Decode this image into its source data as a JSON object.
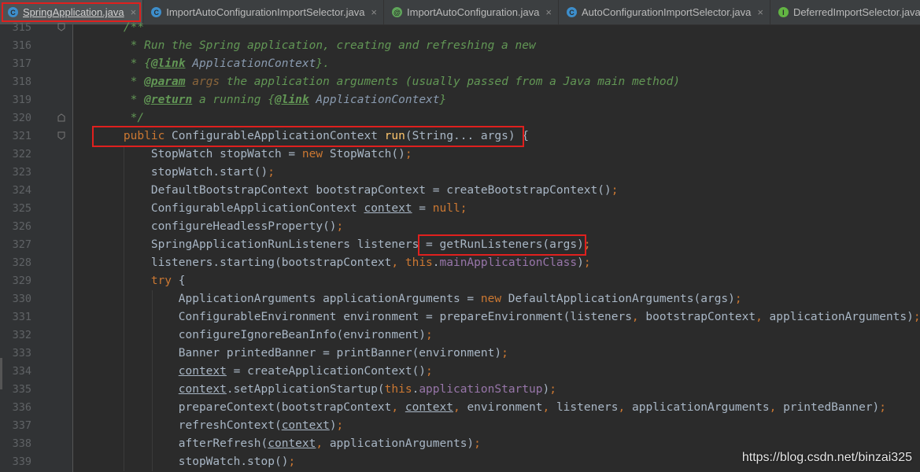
{
  "tabs": [
    {
      "label": "SpringApplication.java",
      "icon": "class-icon",
      "icon_letter": "C",
      "icon_color": "#3d8ecb",
      "active": true
    },
    {
      "label": "ImportAutoConfigurationImportSelector.java",
      "icon": "class-icon",
      "icon_letter": "C",
      "icon_color": "#3d8ecb",
      "active": false
    },
    {
      "label": "ImportAutoConfiguration.java",
      "icon": "annotation-icon",
      "icon_letter": "@",
      "icon_color": "#5fa55a",
      "active": false
    },
    {
      "label": "AutoConfigurationImportSelector.java",
      "icon": "class-icon",
      "icon_letter": "C",
      "icon_color": "#3d8ecb",
      "active": false
    },
    {
      "label": "DeferredImportSelector.java",
      "icon": "interface-icon",
      "icon_letter": "I",
      "icon_color": "#62b543",
      "active": false
    }
  ],
  "close_glyph": "×",
  "editor": {
    "lines": [
      {
        "num": "315",
        "segments": [
          {
            "t": "    /**",
            "c": "doc"
          }
        ]
      },
      {
        "num": "316",
        "segments": [
          {
            "t": "     * Run the Spring application, creating and refreshing a new",
            "c": "doc"
          }
        ]
      },
      {
        "num": "317",
        "segments": [
          {
            "t": "     * {",
            "c": "doc"
          },
          {
            "t": "@link",
            "c": "doctag"
          },
          {
            "t": " ApplicationContext",
            "c": "docref"
          },
          {
            "t": "}.",
            "c": "doc"
          }
        ]
      },
      {
        "num": "318",
        "segments": [
          {
            "t": "     * ",
            "c": "doc"
          },
          {
            "t": "@param",
            "c": "doctag"
          },
          {
            "t": " args",
            "c": "docparam"
          },
          {
            "t": " the application arguments (usually passed from a Java main method)",
            "c": "doc"
          }
        ]
      },
      {
        "num": "319",
        "segments": [
          {
            "t": "     * ",
            "c": "doc"
          },
          {
            "t": "@return",
            "c": "doctag"
          },
          {
            "t": " a running {",
            "c": "doc"
          },
          {
            "t": "@link",
            "c": "doctag"
          },
          {
            "t": " ApplicationContext",
            "c": "docref"
          },
          {
            "t": "}",
            "c": "doc"
          }
        ]
      },
      {
        "num": "320",
        "segments": [
          {
            "t": "     */",
            "c": "doc"
          }
        ]
      },
      {
        "num": "321",
        "segments": [
          {
            "t": "    ",
            "c": "plain"
          },
          {
            "t": "public",
            "c": "kw"
          },
          {
            "t": " ConfigurableApplicationContext ",
            "c": "plain"
          },
          {
            "t": "run",
            "c": "method"
          },
          {
            "t": "(String... args) {",
            "c": "plain"
          }
        ]
      },
      {
        "num": "322",
        "segments": [
          {
            "t": "        StopWatch stopWatch = ",
            "c": "plain"
          },
          {
            "t": "new",
            "c": "kw"
          },
          {
            "t": " StopWatch()",
            "c": "plain"
          },
          {
            "t": ";",
            "c": "kw"
          }
        ]
      },
      {
        "num": "323",
        "segments": [
          {
            "t": "        stopWatch.start()",
            "c": "plain"
          },
          {
            "t": ";",
            "c": "kw"
          }
        ]
      },
      {
        "num": "324",
        "segments": [
          {
            "t": "        DefaultBootstrapContext bootstrapContext = createBootstrapContext()",
            "c": "plain"
          },
          {
            "t": ";",
            "c": "kw"
          }
        ]
      },
      {
        "num": "325",
        "segments": [
          {
            "t": "        ConfigurableApplicationContext ",
            "c": "plain"
          },
          {
            "t": "context",
            "c": "var"
          },
          {
            "t": " = ",
            "c": "plain"
          },
          {
            "t": "null;",
            "c": "kw"
          }
        ]
      },
      {
        "num": "326",
        "segments": [
          {
            "t": "        configureHeadlessProperty()",
            "c": "plain"
          },
          {
            "t": ";",
            "c": "kw"
          }
        ]
      },
      {
        "num": "327",
        "segments": [
          {
            "t": "        SpringApplicationRunListeners listeners = getRunListeners(args)",
            "c": "plain"
          },
          {
            "t": ";",
            "c": "kw"
          }
        ]
      },
      {
        "num": "328",
        "segments": [
          {
            "t": "        listeners.starting(bootstrapContext",
            "c": "plain"
          },
          {
            "t": ", ",
            "c": "kw"
          },
          {
            "t": "this",
            "c": "kw"
          },
          {
            "t": ".",
            "c": "plain"
          },
          {
            "t": "mainApplicationClass",
            "c": "field"
          },
          {
            "t": ")",
            "c": "plain"
          },
          {
            "t": ";",
            "c": "kw"
          }
        ]
      },
      {
        "num": "329",
        "segments": [
          {
            "t": "        ",
            "c": "plain"
          },
          {
            "t": "try",
            "c": "kw"
          },
          {
            "t": " {",
            "c": "plain"
          }
        ]
      },
      {
        "num": "330",
        "segments": [
          {
            "t": "            ApplicationArguments applicationArguments = ",
            "c": "plain"
          },
          {
            "t": "new",
            "c": "kw"
          },
          {
            "t": " DefaultApplicationArguments(args)",
            "c": "plain"
          },
          {
            "t": ";",
            "c": "kw"
          }
        ]
      },
      {
        "num": "331",
        "segments": [
          {
            "t": "            ConfigurableEnvironment environment = prepareEnvironment(listeners",
            "c": "plain"
          },
          {
            "t": ", ",
            "c": "kw"
          },
          {
            "t": "bootstrapContext",
            "c": "plain"
          },
          {
            "t": ", ",
            "c": "kw"
          },
          {
            "t": "applicationArguments)",
            "c": "plain"
          },
          {
            "t": ";",
            "c": "kw"
          }
        ]
      },
      {
        "num": "332",
        "segments": [
          {
            "t": "            configureIgnoreBeanInfo(environment)",
            "c": "plain"
          },
          {
            "t": ";",
            "c": "kw"
          }
        ]
      },
      {
        "num": "333",
        "segments": [
          {
            "t": "            Banner printedBanner = printBanner(environment)",
            "c": "plain"
          },
          {
            "t": ";",
            "c": "kw"
          }
        ]
      },
      {
        "num": "334",
        "segments": [
          {
            "t": "            ",
            "c": "plain"
          },
          {
            "t": "context",
            "c": "var"
          },
          {
            "t": " = createApplicationContext()",
            "c": "plain"
          },
          {
            "t": ";",
            "c": "kw"
          }
        ]
      },
      {
        "num": "335",
        "segments": [
          {
            "t": "            ",
            "c": "plain"
          },
          {
            "t": "context",
            "c": "var"
          },
          {
            "t": ".setApplicationStartup(",
            "c": "plain"
          },
          {
            "t": "this",
            "c": "kw"
          },
          {
            "t": ".",
            "c": "plain"
          },
          {
            "t": "applicationStartup",
            "c": "field"
          },
          {
            "t": ")",
            "c": "plain"
          },
          {
            "t": ";",
            "c": "kw"
          }
        ]
      },
      {
        "num": "336",
        "segments": [
          {
            "t": "            prepareContext(bootstrapContext",
            "c": "plain"
          },
          {
            "t": ", ",
            "c": "kw"
          },
          {
            "t": "context",
            "c": "var"
          },
          {
            "t": ", ",
            "c": "kw"
          },
          {
            "t": "environment",
            "c": "plain"
          },
          {
            "t": ", ",
            "c": "kw"
          },
          {
            "t": "listeners",
            "c": "plain"
          },
          {
            "t": ", ",
            "c": "kw"
          },
          {
            "t": "applicationArguments",
            "c": "plain"
          },
          {
            "t": ", ",
            "c": "kw"
          },
          {
            "t": "printedBanner)",
            "c": "plain"
          },
          {
            "t": ";",
            "c": "kw"
          }
        ]
      },
      {
        "num": "337",
        "segments": [
          {
            "t": "            refreshContext(",
            "c": "plain"
          },
          {
            "t": "context",
            "c": "var"
          },
          {
            "t": ")",
            "c": "plain"
          },
          {
            "t": ";",
            "c": "kw"
          }
        ]
      },
      {
        "num": "338",
        "segments": [
          {
            "t": "            afterRefresh(",
            "c": "plain"
          },
          {
            "t": "context",
            "c": "var"
          },
          {
            "t": ", ",
            "c": "kw"
          },
          {
            "t": "applicationArguments)",
            "c": "plain"
          },
          {
            "t": ";",
            "c": "kw"
          }
        ]
      },
      {
        "num": "339",
        "segments": [
          {
            "t": "            stopWatch.stop()",
            "c": "plain"
          },
          {
            "t": ";",
            "c": "kw"
          }
        ]
      }
    ]
  },
  "colors": {
    "plain": "#a9b7c6",
    "kw": "#cc7832",
    "doc": "#629755",
    "doctag": "#629755",
    "docref": "#8a9bb0",
    "docparam": "#8a653b",
    "method": "#ffc66d",
    "field": "#9876aa",
    "var": "#a9b7c6",
    "highlight": "#e0201e"
  },
  "watermark": "https://blog.csdn.net/binzai325"
}
